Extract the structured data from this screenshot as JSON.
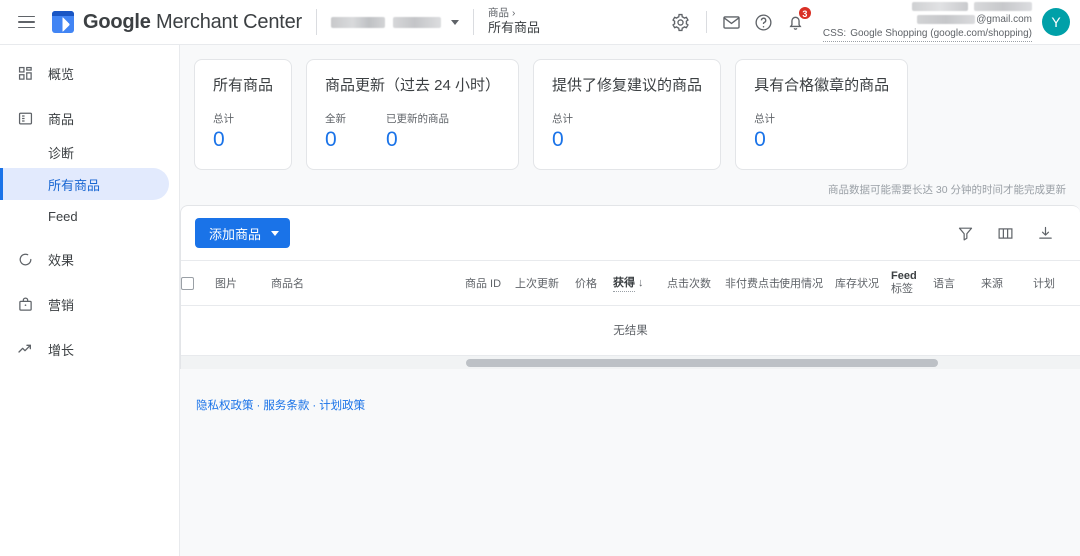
{
  "header": {
    "menu_icon": "hamburger-menu-icon",
    "logo_icon": "merchant-center-logo-icon",
    "brand_google": "Google",
    "brand_product": " Merchant Center",
    "account_picker_label": "",
    "breadcrumb": {
      "parent": "商品",
      "chevron": "›",
      "current": "所有商品"
    },
    "icons": {
      "settings": "gear-icon",
      "mail": "mail-icon",
      "help": "help-icon",
      "notifications": "bell-icon"
    },
    "notification_count": "3",
    "account_email": "@gmail.com",
    "css_label": "CSS:",
    "css_value": "Google Shopping (google.com/shopping)",
    "avatar_initial": "Y"
  },
  "sidebar": {
    "items": [
      {
        "label": "概览",
        "icon": "dashboard-icon",
        "type": "top"
      },
      {
        "label": "商品",
        "icon": "products-icon",
        "type": "top"
      },
      {
        "label": "诊断",
        "icon": "",
        "type": "sub"
      },
      {
        "label": "所有商品",
        "icon": "",
        "type": "sub",
        "active": true
      },
      {
        "label": "Feed",
        "icon": "",
        "type": "sub"
      },
      {
        "label": "效果",
        "icon": "performance-icon",
        "type": "top"
      },
      {
        "label": "营销",
        "icon": "marketing-icon",
        "type": "top"
      },
      {
        "label": "增长",
        "icon": "growth-icon",
        "type": "top"
      }
    ]
  },
  "cards": [
    {
      "title": "所有商品",
      "metrics": [
        {
          "label": "总计",
          "value": "0"
        }
      ]
    },
    {
      "title": "商品更新（过去 24 小时）",
      "metrics": [
        {
          "label": "全新",
          "value": "0"
        },
        {
          "label": "已更新的商品",
          "value": "0"
        }
      ]
    },
    {
      "title": "提供了修复建议的商品",
      "metrics": [
        {
          "label": "总计",
          "value": "0"
        }
      ]
    },
    {
      "title": "具有合格徽章的商品",
      "metrics": [
        {
          "label": "总计",
          "value": "0"
        }
      ]
    }
  ],
  "update_note": "商品数据可能需要长达 30 分钟的时间才能完成更新",
  "toolbar": {
    "add_button_label": "添加商品",
    "filter_icon": "filter-icon",
    "columns_icon": "columns-icon",
    "download_icon": "download-icon"
  },
  "table": {
    "columns": [
      "图片",
      "商品名",
      "商品 ID",
      "上次更新",
      "价格",
      "获得",
      "点击次数",
      "非付费点击",
      "使用情况",
      "库存状况",
      "语言",
      "来源",
      "计划"
    ],
    "feed_label_line1": "Feed",
    "feed_label_line2": "标签",
    "sort_column": "获得",
    "sort_arrow": "↓",
    "empty_message": "无结果"
  },
  "footer": {
    "links": [
      "隐私权政策",
      "服务条款",
      "计划政策"
    ],
    "separator": "·"
  },
  "colors": {
    "accent_blue": "#1a73e8",
    "badge_red": "#d93025",
    "avatar_teal": "#00a0a8",
    "nav_active_bg": "#e2eafd",
    "page_bg": "#f8f9fa"
  }
}
